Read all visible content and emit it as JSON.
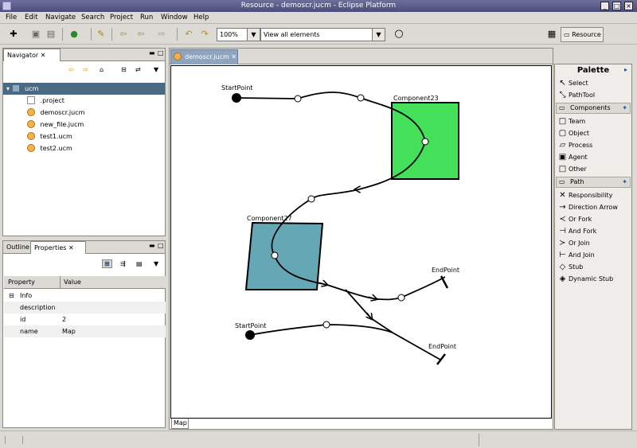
{
  "window": {
    "title": "Resource - demoscr.jucm - Eclipse Platform",
    "controls": {
      "minimize": "_",
      "maximize": "□",
      "close": "×"
    }
  },
  "menus": [
    "File",
    "Edit",
    "Navigate",
    "Search",
    "Project",
    "Run",
    "Window",
    "Help"
  ],
  "toolbar": {
    "zoom": "100%",
    "view": "View all elements"
  },
  "perspective": {
    "label": "Resource"
  },
  "navigator": {
    "tab": "Navigator",
    "items": [
      {
        "label": "ucm",
        "type": "folder",
        "selected": true
      },
      {
        "label": ".project",
        "type": "project"
      },
      {
        "label": "demoscr.jucm",
        "type": "ucm"
      },
      {
        "label": "new_file.jucm",
        "type": "ucm"
      },
      {
        "label": "test1.ucm",
        "type": "ucm"
      },
      {
        "label": "test2.ucm",
        "type": "ucm"
      }
    ]
  },
  "bottom_panel": {
    "tabs": [
      "Outline",
      "Properties"
    ],
    "columns": [
      "Property",
      "Value"
    ],
    "rows": [
      {
        "property": "Info",
        "value": "",
        "group": true
      },
      {
        "property": "description",
        "value": ""
      },
      {
        "property": "id",
        "value": "2"
      },
      {
        "property": "name",
        "value": "Map"
      }
    ]
  },
  "editor": {
    "tab": "demoscr.jucm",
    "bottom_tab": "Map",
    "labels": {
      "start1": "StartPoint",
      "start2": "StartPoint",
      "comp23": "Component23",
      "comp27": "Component27",
      "end1": "EndPoint",
      "end2": "EndPoint"
    },
    "colors": {
      "component23": "#44e05a",
      "component27": "#66a7b6"
    }
  },
  "palette": {
    "title": "Palette",
    "tools": [
      {
        "label": "Select",
        "icon": "arrow-cursor-icon"
      },
      {
        "label": "PathTool",
        "icon": "path-tool-icon"
      }
    ],
    "sections": [
      {
        "label": "Components",
        "items": [
          {
            "label": "Team",
            "icon": "square-icon"
          },
          {
            "label": "Object",
            "icon": "rounded-square-icon"
          },
          {
            "label": "Process",
            "icon": "parallelogram-icon"
          },
          {
            "label": "Agent",
            "icon": "thick-square-icon"
          },
          {
            "label": "Other",
            "icon": "square-icon"
          }
        ]
      },
      {
        "label": "Path",
        "items": [
          {
            "label": "Responsibility",
            "icon": "x-icon"
          },
          {
            "label": "Direction Arrow",
            "icon": "arrow-icon"
          },
          {
            "label": "Or Fork",
            "icon": "or-fork-icon"
          },
          {
            "label": "And Fork",
            "icon": "and-fork-icon"
          },
          {
            "label": "Or Join",
            "icon": "or-join-icon"
          },
          {
            "label": "And Join",
            "icon": "and-join-icon"
          },
          {
            "label": "Stub",
            "icon": "diamond-icon"
          },
          {
            "label": "Dynamic Stub",
            "icon": "dynamic-diamond-icon"
          }
        ]
      }
    ]
  }
}
